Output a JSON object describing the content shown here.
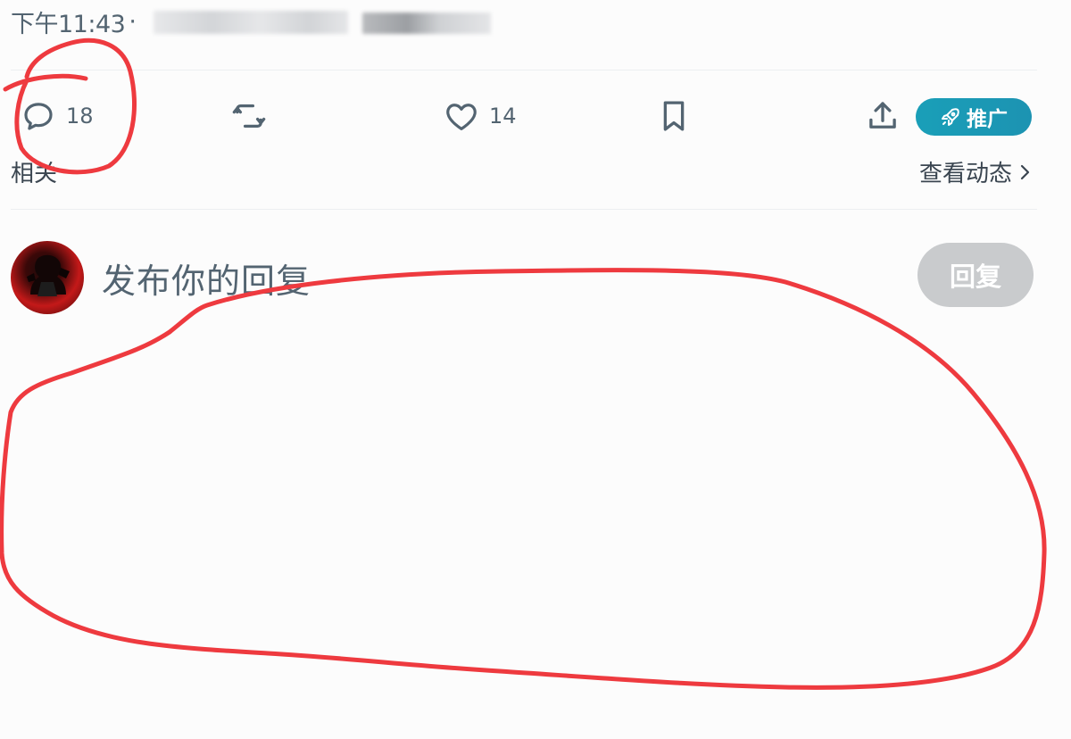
{
  "meta": {
    "time": "下午11:43",
    "separator": "·"
  },
  "actions": {
    "reply_count": "18",
    "like_count": "14",
    "promote_label": "推广"
  },
  "related": {
    "label": "相关",
    "view_activity": "查看动态"
  },
  "compose": {
    "placeholder": "发布你的回复",
    "reply_button": "回复"
  },
  "colors": {
    "accent_promote": "#1a9fb8",
    "annotation_red": "#ee3a3f",
    "muted_text": "#536471",
    "disabled_button": "#c9cbcd"
  },
  "icons": {
    "reply": "speech-bubble-icon",
    "retweet": "repost-icon",
    "like": "heart-icon",
    "bookmark": "bookmark-icon",
    "share": "share-upload-icon",
    "promote": "rocket-icon",
    "chevron": "chevron-right-icon"
  }
}
